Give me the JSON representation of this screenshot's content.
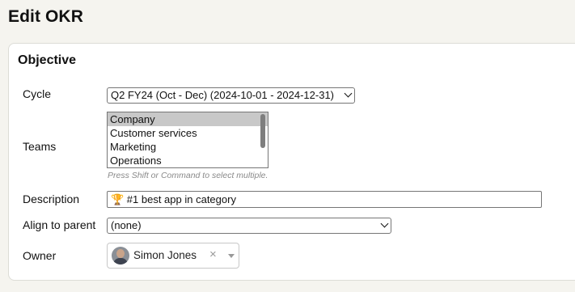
{
  "page": {
    "title": "Edit OKR"
  },
  "objective": {
    "section_title": "Objective",
    "cycle": {
      "label": "Cycle",
      "selected": "Q2 FY24 (Oct - Dec) (2024-10-01 - 2024-12-31)"
    },
    "teams": {
      "label": "Teams",
      "options": [
        {
          "label": "Company",
          "selected": true
        },
        {
          "label": "Customer services",
          "selected": false
        },
        {
          "label": "Marketing",
          "selected": false
        },
        {
          "label": "Operations",
          "selected": false
        }
      ],
      "hint": "Press Shift or Command to select multiple."
    },
    "description": {
      "label": "Description",
      "value": "🏆 #1 best app in category"
    },
    "align_to_parent": {
      "label": "Align to parent",
      "selected": "(none)"
    },
    "owner": {
      "label": "Owner",
      "name": "Simon Jones",
      "clear_glyph": "×",
      "icons": [
        "avatar",
        "clear-icon",
        "dropdown-arrow-icon"
      ]
    }
  }
}
